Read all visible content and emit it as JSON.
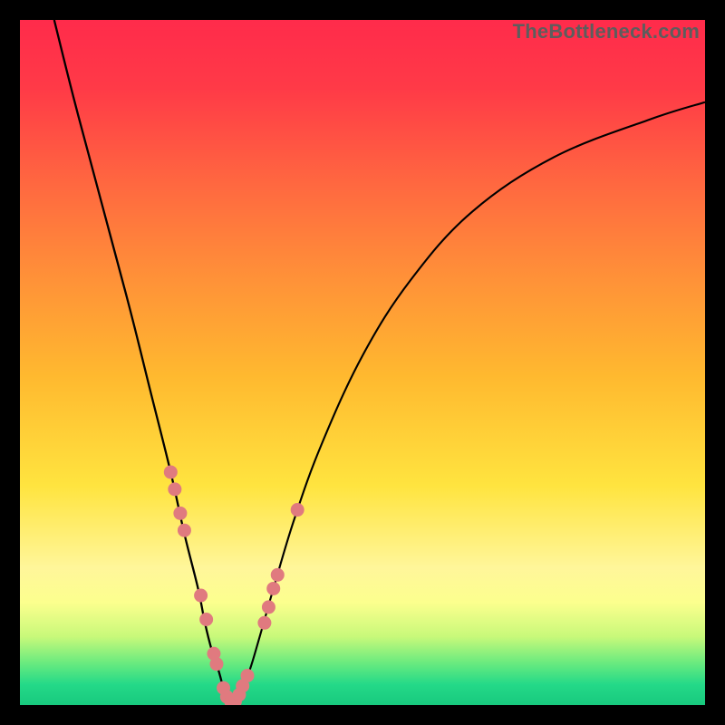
{
  "watermark": "TheBottleneck.com",
  "colors": {
    "frame": "#000000",
    "curve": "#000000",
    "dots": "#e07a7f",
    "bottom_line": "#18c97e"
  },
  "chart_data": {
    "type": "line",
    "title": "",
    "xlabel": "",
    "ylabel": "",
    "xlim": [
      0,
      100
    ],
    "ylim": [
      0,
      100
    ],
    "series": [
      {
        "name": "bottleneck-curve-left",
        "x": [
          5,
          8,
          12,
          16,
          19,
          22,
          24,
          26,
          27,
          28,
          29,
          29.7,
          30.3,
          31
        ],
        "y": [
          100,
          88,
          73,
          58,
          46,
          34,
          25,
          17,
          12,
          8,
          5,
          2.5,
          1,
          0
        ]
      },
      {
        "name": "bottleneck-curve-right",
        "x": [
          31,
          32,
          33.5,
          35,
          37,
          40,
          44,
          50,
          57,
          66,
          78,
          92,
          100
        ],
        "y": [
          0,
          1.5,
          5,
          10,
          17,
          27,
          38,
          51,
          62,
          72,
          80,
          85.5,
          88
        ]
      }
    ],
    "dots": [
      {
        "x": 22.0,
        "y": 34
      },
      {
        "x": 22.6,
        "y": 31.5
      },
      {
        "x": 23.4,
        "y": 28
      },
      {
        "x": 24.0,
        "y": 25.5
      },
      {
        "x": 26.4,
        "y": 16
      },
      {
        "x": 27.2,
        "y": 12.5
      },
      {
        "x": 28.3,
        "y": 7.5
      },
      {
        "x": 28.7,
        "y": 6
      },
      {
        "x": 29.7,
        "y": 2.5
      },
      {
        "x": 30.2,
        "y": 1.2
      },
      {
        "x": 30.8,
        "y": 0.5
      },
      {
        "x": 31.4,
        "y": 0.5
      },
      {
        "x": 32.0,
        "y": 1.5
      },
      {
        "x": 32.5,
        "y": 2.8
      },
      {
        "x": 33.2,
        "y": 4.3
      },
      {
        "x": 35.7,
        "y": 12
      },
      {
        "x": 36.3,
        "y": 14.3
      },
      {
        "x": 37.0,
        "y": 17
      },
      {
        "x": 37.6,
        "y": 19
      },
      {
        "x": 40.5,
        "y": 28.5
      }
    ]
  }
}
